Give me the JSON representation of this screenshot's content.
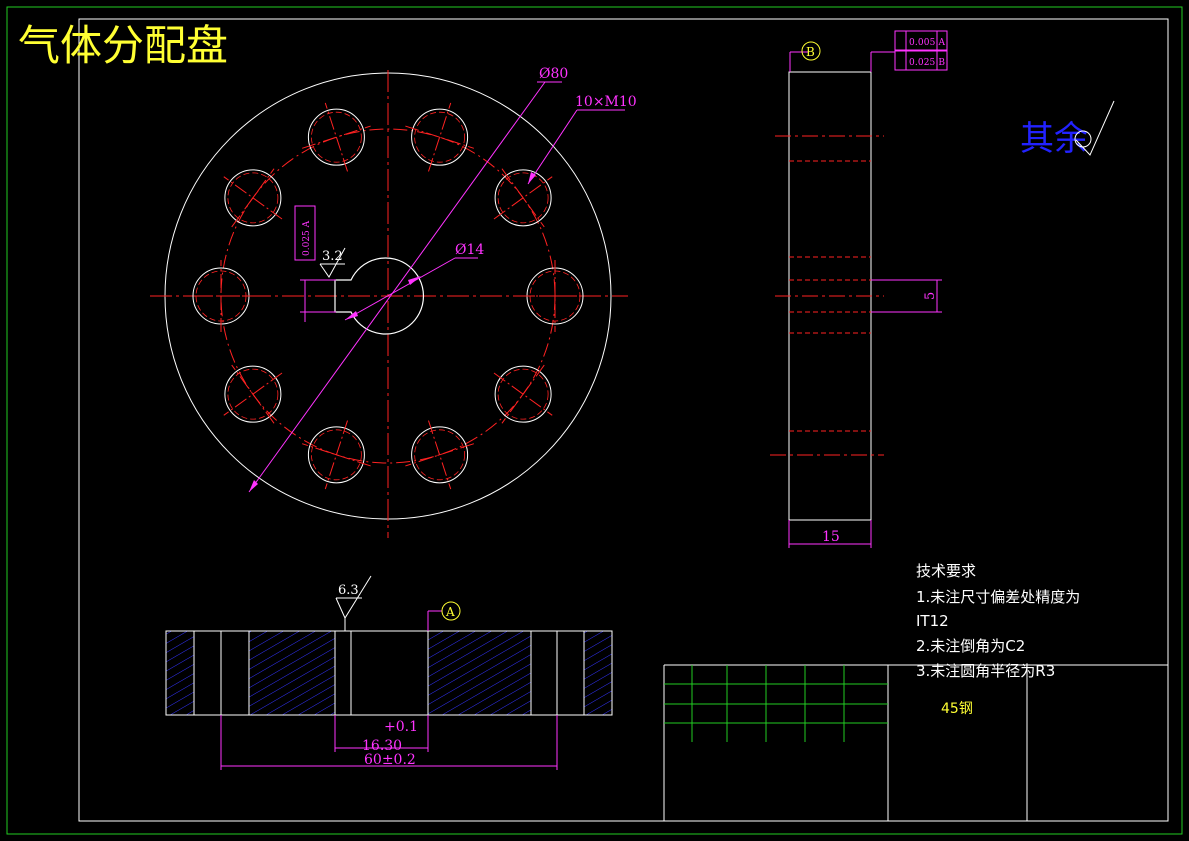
{
  "title": "气体分配盘",
  "front_view": {
    "dim_outer": "Ø80",
    "dim_holes": "10×M10",
    "dim_bore": "Ø14",
    "roughness_keyway": "3.2",
    "tolerance_keyway": "0.025 A"
  },
  "side_view": {
    "datum": "B",
    "tolerance_flatness": "0.005 A",
    "tolerance_parallel": "0.025 B",
    "dim_thickness": "15",
    "dim_keyway": "5"
  },
  "section_view": {
    "roughness": "6.3",
    "datum": "A",
    "dim_tol": "+0.1",
    "dim_keyway_width": "16.30",
    "dim_total": "60±0.2"
  },
  "surface_note": "其余",
  "requirements": {
    "heading": "技术要求",
    "items": [
      "1.未注尺寸偏差处精度为",
      "IT12",
      "2.未注倒角为C2",
      "3.未注圆角半径为R3"
    ]
  },
  "material": "45钢",
  "colors": {
    "frame": "#22cc22",
    "outline": "#ffffff",
    "center_line": "#ff2222",
    "dimension": "#ff33ff",
    "title": "#ffff33",
    "hatch": "#3333ff",
    "note_blue": "#2222ff"
  }
}
